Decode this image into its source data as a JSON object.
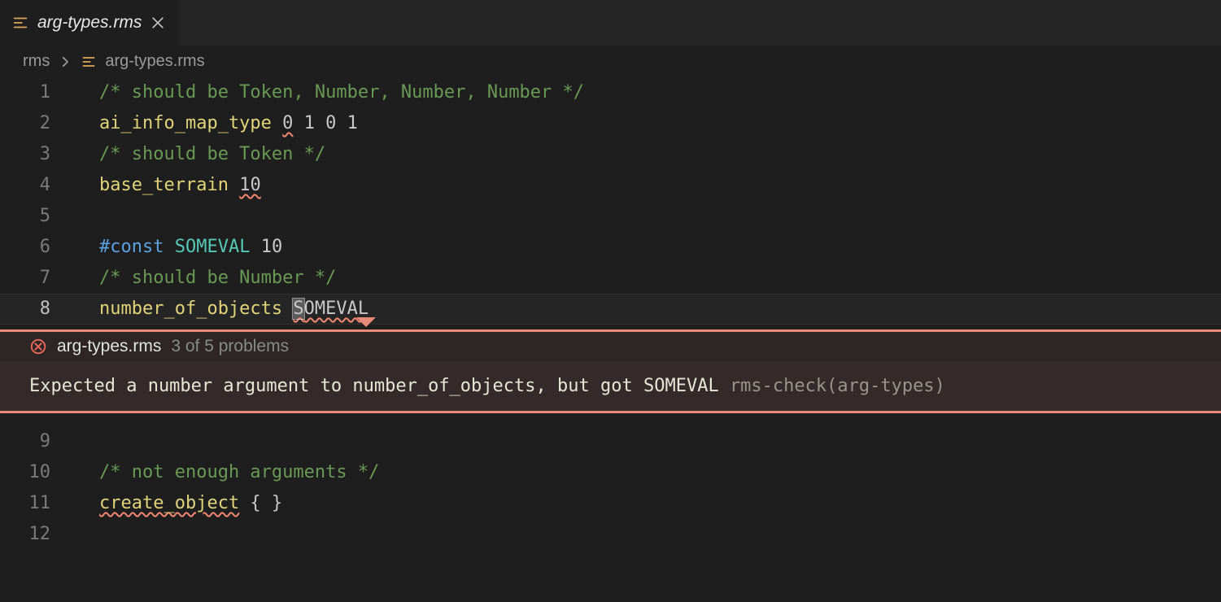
{
  "tab": {
    "label": "arg-types.rms"
  },
  "breadcrumb": {
    "folder": "rms",
    "file": "arg-types.rms"
  },
  "lines": [
    {
      "no": "1"
    },
    {
      "no": "2"
    },
    {
      "no": "3"
    },
    {
      "no": "4"
    },
    {
      "no": "5"
    },
    {
      "no": "6"
    },
    {
      "no": "7"
    },
    {
      "no": "8"
    },
    {
      "no": "9"
    },
    {
      "no": "10"
    },
    {
      "no": "11"
    },
    {
      "no": "12"
    }
  ],
  "code": {
    "l1_comment": "/* should be Token, Number, Number, Number */",
    "l2_ident": "ai_info_map_type",
    "l2_arg1": "0",
    "l2_rest": " 1 0 1",
    "l3_comment": "/* should be Token */",
    "l4_ident": "base_terrain",
    "l4_arg": "10",
    "l6_keyword": "#const",
    "l6_name": "SOMEVAL",
    "l6_val": "10",
    "l7_comment": "/* should be Number */",
    "l8_ident": "number_of_objects",
    "l8_arg_first": "S",
    "l8_arg_rest": "OMEVAL",
    "l10_comment": "/* not enough arguments */",
    "l11_ident": "create_object",
    "l11_rest": " { }"
  },
  "error": {
    "header_file": "arg-types.rms",
    "header_counts": "3 of 5 problems",
    "message": "Expected a number argument to number_of_objects, but got SOMEVAL",
    "source": "rms-check(arg-types)"
  }
}
